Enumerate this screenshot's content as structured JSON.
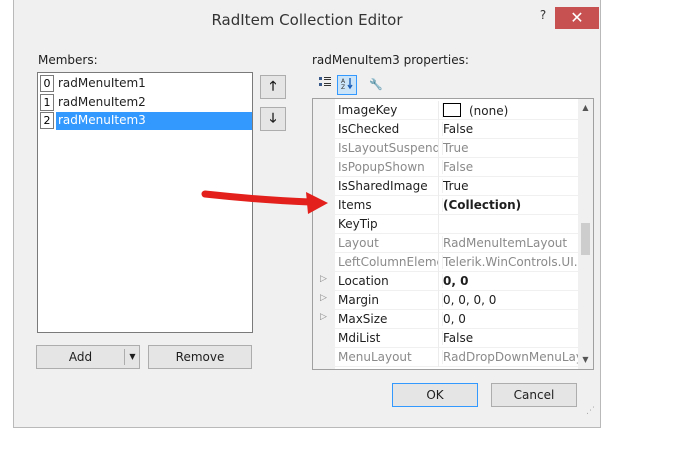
{
  "window": {
    "title": "RadItem Collection Editor",
    "help_label": "?",
    "close_label": "✕"
  },
  "members": {
    "label": "Members:",
    "items": [
      {
        "index": "0",
        "name": "radMenuItem1"
      },
      {
        "index": "1",
        "name": "radMenuItem2"
      },
      {
        "index": "2",
        "name": "radMenuItem3",
        "selected": true
      }
    ],
    "move_up_icon": "arrow-up",
    "move_down_icon": "arrow-down",
    "add_label": "Add",
    "remove_label": "Remove"
  },
  "properties": {
    "label": "radMenuItem3 properties:",
    "toolbar_icons": [
      "categorized-icon",
      "alphabetical-icon",
      "property-pages-icon"
    ],
    "rows": [
      {
        "name": "ImageKey",
        "value": "(none)",
        "swatch": true,
        "dim": false,
        "bold": false,
        "expandable": false
      },
      {
        "name": "IsChecked",
        "value": "False",
        "dim": false,
        "bold": false,
        "expandable": false
      },
      {
        "name": "IsLayoutSuspended",
        "value": "True",
        "dim": true,
        "bold": false,
        "expandable": false
      },
      {
        "name": "IsPopupShown",
        "value": "False",
        "dim": true,
        "bold": false,
        "expandable": false
      },
      {
        "name": "IsSharedImage",
        "value": "True",
        "dim": false,
        "bold": false,
        "expandable": false
      },
      {
        "name": "Items",
        "value": "(Collection)",
        "dim": false,
        "bold": true,
        "expandable": false
      },
      {
        "name": "KeyTip",
        "value": "",
        "dim": false,
        "bold": false,
        "expandable": false
      },
      {
        "name": "Layout",
        "value": "RadMenuItemLayout",
        "dim": true,
        "bold": false,
        "expandable": false
      },
      {
        "name": "LeftColumnElement",
        "value": "Telerik.WinControls.UI.",
        "dim": true,
        "bold": false,
        "expandable": false
      },
      {
        "name": "Location",
        "value": "0, 0",
        "dim": false,
        "bold": true,
        "expandable": true
      },
      {
        "name": "Margin",
        "value": "0, 0, 0, 0",
        "dim": false,
        "bold": false,
        "expandable": true
      },
      {
        "name": "MaxSize",
        "value": "0, 0",
        "dim": false,
        "bold": false,
        "expandable": true
      },
      {
        "name": "MdiList",
        "value": "False",
        "dim": false,
        "bold": false,
        "expandable": false
      },
      {
        "name": "MenuLayout",
        "value": "RadDropDownMenuLayout",
        "dim": true,
        "bold": false,
        "expandable": false
      }
    ]
  },
  "footer": {
    "ok_label": "OK",
    "cancel_label": "Cancel"
  },
  "annotation": {
    "arrow_color": "#e3201b"
  }
}
